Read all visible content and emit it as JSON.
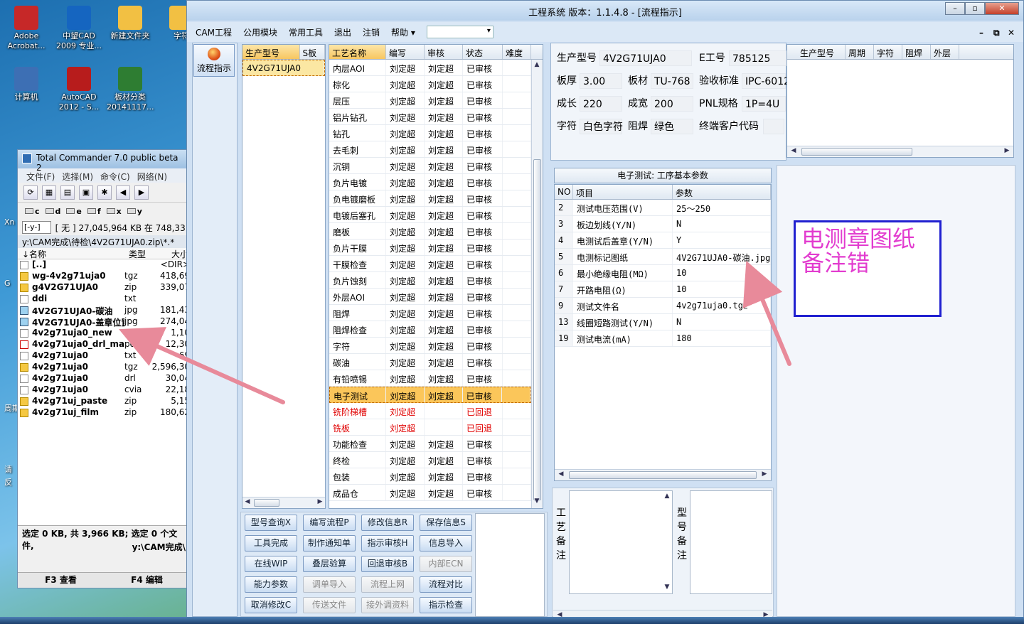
{
  "desktop": {
    "icons": [
      {
        "label": "Adobe Acrobat...",
        "icon": "acrobat-icon",
        "color": "#c62828"
      },
      {
        "label": "中望CAD 2009 专业...",
        "icon": "cad-icon",
        "color": "#1565c0"
      },
      {
        "label": "新建文件夹",
        "icon": "folder-icon",
        "color": "#f2c043"
      },
      {
        "label": "字符",
        "icon": "doc-icon",
        "color": "#f2c043"
      },
      {
        "label": "计算机",
        "icon": "computer-icon",
        "color": "#3d6fb4"
      },
      {
        "label": "AutoCAD 2012 - S...",
        "icon": "autocad-icon",
        "color": "#b71c1c"
      },
      {
        "label": "板材分类 20141117...",
        "icon": "excel-icon",
        "color": "#2e7d32"
      }
    ],
    "edge_labels": [
      "Xn",
      "G",
      "周期",
      "请",
      "反"
    ]
  },
  "tc": {
    "title": "Total Commander 7.0 public beta 2",
    "menu": [
      "文件(F)",
      "选择(M)",
      "命令(C)",
      "网络(N)"
    ],
    "drives": [
      "c",
      "d",
      "e",
      "f",
      "x",
      "y"
    ],
    "drive_select": "[-y-]",
    "drive_info": "[ 无 ]  27,045,964 KB 在 748,33",
    "path": "y:\\CAM完成\\待检\\4V2G71UJA0.zip\\*.*",
    "columns": [
      "↓名称",
      "类型",
      "大小"
    ],
    "files": [
      {
        "name": "[..]",
        "type": "",
        "size": "<DIR>",
        "icon": "up"
      },
      {
        "name": "wg-4v2g71uja0",
        "type": "tgz",
        "size": "418,69",
        "icon": "arc"
      },
      {
        "name": "g4V2G71UJA0",
        "type": "zip",
        "size": "339,07",
        "icon": "arc"
      },
      {
        "name": "ddi",
        "type": "txt",
        "size": "",
        "icon": "doc"
      },
      {
        "name": "4V2G71UJA0-碳油",
        "type": "jpg",
        "size": "181,43",
        "icon": "img"
      },
      {
        "name": "4V2G71UJA0-盖章位置",
        "type": "jpg",
        "size": "274,04",
        "icon": "img"
      },
      {
        "name": "4v2g71uja0_new",
        "type": "txt",
        "size": "1,10",
        "icon": "doc"
      },
      {
        "name": "4v2g71uja0_drl_map",
        "type": "pdf",
        "size": "12,30",
        "icon": "pdf"
      },
      {
        "name": "4v2g71uja0",
        "type": "txt",
        "size": "69",
        "icon": "doc"
      },
      {
        "name": "4v2g71uja0",
        "type": "tgz",
        "size": "2,596,30",
        "icon": "arc"
      },
      {
        "name": "4v2g71uja0",
        "type": "drl",
        "size": "30,04",
        "icon": "doc"
      },
      {
        "name": "4v2g71uja0",
        "type": "cvia",
        "size": "22,18",
        "icon": "doc"
      },
      {
        "name": "4v2g71uj_paste",
        "type": "zip",
        "size": "5,15",
        "icon": "arc"
      },
      {
        "name": "4v2g71uj_film",
        "type": "zip",
        "size": "180,62",
        "icon": "arc"
      }
    ],
    "status1": "选定 0 KB, 共 3,966 KB; 选定 0 个文件,",
    "status2": "y:\\CAM完成\\",
    "fkeys": [
      "F3 查看",
      "F4 编辑"
    ]
  },
  "main": {
    "title": "工程系统   版本：1.1.4.8 - [流程指示]",
    "menu": [
      "CAM工程",
      "公用模块",
      "常用工具",
      "退出",
      "注销",
      "帮助"
    ],
    "flow_button": "流程指示",
    "model_grid": {
      "columns": [
        "生产型号",
        "S板"
      ],
      "rows": [
        "4V2G71UJA0"
      ]
    },
    "process_grid": {
      "columns": [
        "工艺名称",
        "编写",
        "审核",
        "状态",
        "难度"
      ],
      "rows": [
        [
          "内层AOI",
          "刘定超",
          "刘定超",
          "已审核",
          ""
        ],
        [
          "棕化",
          "刘定超",
          "刘定超",
          "已审核",
          ""
        ],
        [
          "层压",
          "刘定超",
          "刘定超",
          "已审核",
          ""
        ],
        [
          "铝片钻孔",
          "刘定超",
          "刘定超",
          "已审核",
          ""
        ],
        [
          "钻孔",
          "刘定超",
          "刘定超",
          "已审核",
          ""
        ],
        [
          "去毛刺",
          "刘定超",
          "刘定超",
          "已审核",
          ""
        ],
        [
          "沉铜",
          "刘定超",
          "刘定超",
          "已审核",
          ""
        ],
        [
          "负片电镀",
          "刘定超",
          "刘定超",
          "已审核",
          ""
        ],
        [
          "负电镀磨板",
          "刘定超",
          "刘定超",
          "已审核",
          ""
        ],
        [
          "电镀后塞孔",
          "刘定超",
          "刘定超",
          "已审核",
          ""
        ],
        [
          "磨板",
          "刘定超",
          "刘定超",
          "已审核",
          ""
        ],
        [
          "负片干膜",
          "刘定超",
          "刘定超",
          "已审核",
          ""
        ],
        [
          "干膜检查",
          "刘定超",
          "刘定超",
          "已审核",
          ""
        ],
        [
          "负片蚀刻",
          "刘定超",
          "刘定超",
          "已审核",
          ""
        ],
        [
          "外层AOI",
          "刘定超",
          "刘定超",
          "已审核",
          ""
        ],
        [
          "阻焊",
          "刘定超",
          "刘定超",
          "已审核",
          ""
        ],
        [
          "阻焊检查",
          "刘定超",
          "刘定超",
          "已审核",
          ""
        ],
        [
          "字符",
          "刘定超",
          "刘定超",
          "已审核",
          ""
        ],
        [
          "碳油",
          "刘定超",
          "刘定超",
          "已审核",
          ""
        ],
        [
          "有铅喷锡",
          "刘定超",
          "刘定超",
          "已审核",
          ""
        ],
        [
          "电子测试",
          "刘定超",
          "刘定超",
          "已审核",
          ""
        ],
        [
          "铣阶梯槽",
          "刘定超",
          "",
          "已回退",
          ""
        ],
        [
          "铣板",
          "刘定超",
          "",
          "已回退",
          ""
        ],
        [
          "功能检查",
          "刘定超",
          "刘定超",
          "已审核",
          ""
        ],
        [
          "终检",
          "刘定超",
          "刘定超",
          "已审核",
          ""
        ],
        [
          "包装",
          "刘定超",
          "刘定超",
          "已审核",
          ""
        ],
        [
          "成品仓",
          "刘定超",
          "刘定超",
          "已审核",
          ""
        ]
      ],
      "highlight_index": 20,
      "returned_indices": [
        21,
        22
      ]
    },
    "info": {
      "labels": [
        "生产型号",
        "E工号",
        "板厚",
        "板材",
        "验收标准",
        "成长",
        "成宽",
        "PNL规格",
        "字符",
        "阻焊",
        "终端客户代码"
      ],
      "values": [
        "4V2G71UJA0",
        "785125",
        "3.00",
        "TU-768",
        "IPC-6012",
        "220",
        "200",
        "1P=4U",
        "白色字符",
        "绿色",
        ""
      ]
    },
    "right_grid_columns": [
      "生产型号",
      "周期",
      "字符",
      "阻焊",
      "外层"
    ],
    "etest": {
      "caption": "电子测试: 工序基本参数",
      "columns": [
        "NO",
        "项目",
        "参数"
      ],
      "rows": [
        [
          "2",
          "测试电压范围(V)",
          "25～250"
        ],
        [
          "3",
          "板边划线(Y/N)",
          "N"
        ],
        [
          "4",
          "电测试后盖章(Y/N)",
          "Y"
        ],
        [
          "5",
          "电测标记图纸",
          "4V2G71UJA0-碳油.jpg"
        ],
        [
          "6",
          "最小绝缘电阻(MΩ)",
          "10"
        ],
        [
          "7",
          "开路电阻(Ω)",
          "10"
        ],
        [
          "9",
          "测试文件名",
          "4v2g71uja0.tgz"
        ],
        [
          "13",
          "线圈短路测试(Y/N)",
          "N"
        ],
        [
          "19",
          "测试电流(mA)",
          "180"
        ]
      ]
    },
    "buttons": [
      {
        "label": "型号查询X",
        "enabled": true
      },
      {
        "label": "编写流程P",
        "enabled": true
      },
      {
        "label": "修改信息R",
        "enabled": true
      },
      {
        "label": "保存信息S",
        "enabled": true
      },
      {
        "label": "工具完成",
        "enabled": true
      },
      {
        "label": "制作通知单",
        "enabled": true
      },
      {
        "label": "指示审核H",
        "enabled": true
      },
      {
        "label": "信息导入",
        "enabled": true
      },
      {
        "label": "在线WIP",
        "enabled": true
      },
      {
        "label": "叠层验算",
        "enabled": true
      },
      {
        "label": "回退审核B",
        "enabled": true
      },
      {
        "label": "内部ECN",
        "enabled": false
      },
      {
        "label": "能力参数",
        "enabled": true
      },
      {
        "label": "调单导入",
        "enabled": false
      },
      {
        "label": "流程上网",
        "enabled": false
      },
      {
        "label": "流程对比",
        "enabled": true
      },
      {
        "label": "取消修改C",
        "enabled": true
      },
      {
        "label": "传送文件",
        "enabled": false
      },
      {
        "label": "接外调资料",
        "enabled": false
      },
      {
        "label": "指示检查",
        "enabled": true
      }
    ],
    "memo_labels": [
      "工艺备注",
      "型号备注"
    ]
  },
  "annotation": {
    "text": "电测章图纸备注错",
    "arrow_color": "#e88a9a",
    "box_color": "#2020d0",
    "text_color": "#e23ccf"
  }
}
